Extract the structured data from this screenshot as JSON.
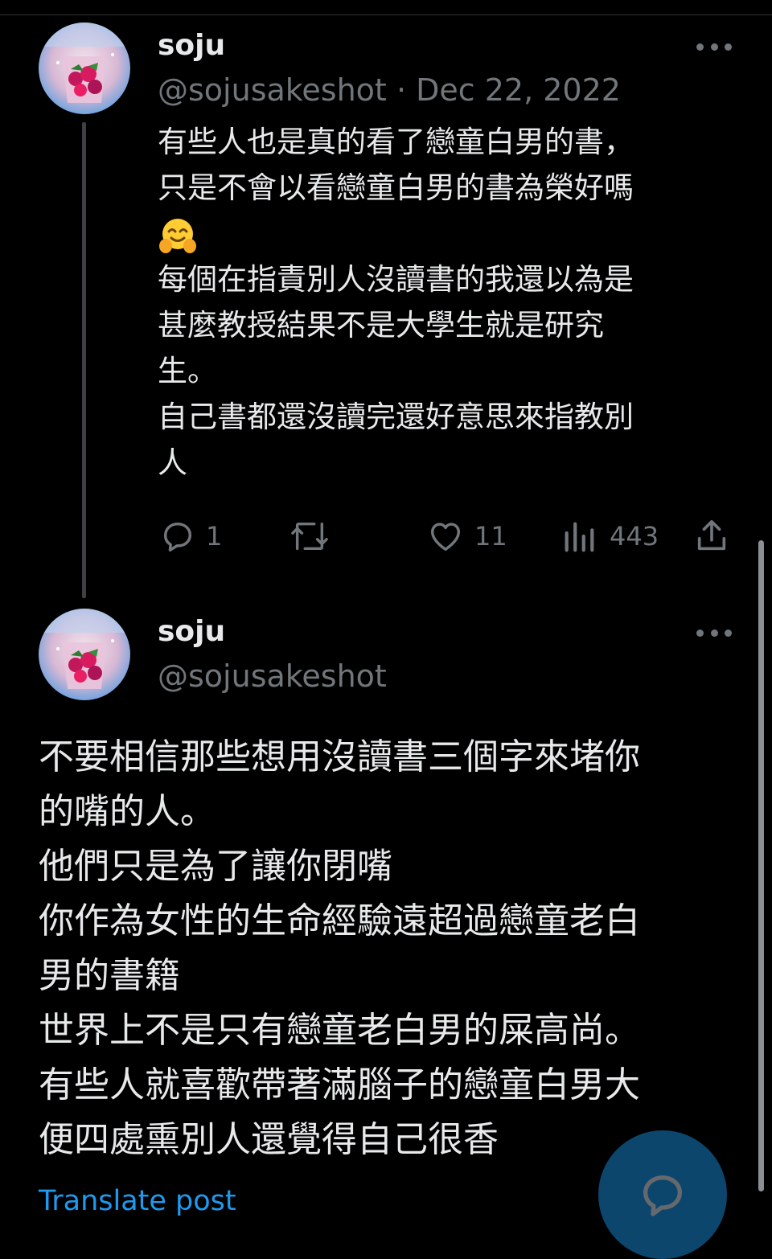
{
  "post1": {
    "name": "soju",
    "handle": "@sojusakeshot",
    "separator": "·",
    "date": "Dec 22, 2022",
    "text_a": "有些人也是真的看了戀童白男的書，\n只是不會以看戀童白男的書為榮好嗎\n",
    "emoji": "hugging-face",
    "text_b": "\n每個在指責別人沒讀書的我還以為是\n甚麼教授結果不是大學生就是研究\n生。\n自己書都還沒讀完還好意思來指教別\n人",
    "actions": {
      "replies": "1",
      "reposts": "",
      "likes": "11",
      "views": "443"
    }
  },
  "post2": {
    "name": "soju",
    "handle": "@sojusakeshot",
    "text": "不要相信那些想用沒讀書三個字來堵你\n的嘴的人。\n他們只是為了讓你閉嘴\n你作為女性的生命經驗遠超過戀童老白\n男的書籍\n世界上不是只有戀童老白男的屎高尚。\n有些人就喜歡帶著滿腦子的戀童白男大\n便四處熏別人還覺得自己很香",
    "translate": "Translate post"
  },
  "colors": {
    "background": "#000000",
    "text": "#e7e9ea",
    "secondary": "#71767b",
    "accent": "#1d9bf0"
  }
}
